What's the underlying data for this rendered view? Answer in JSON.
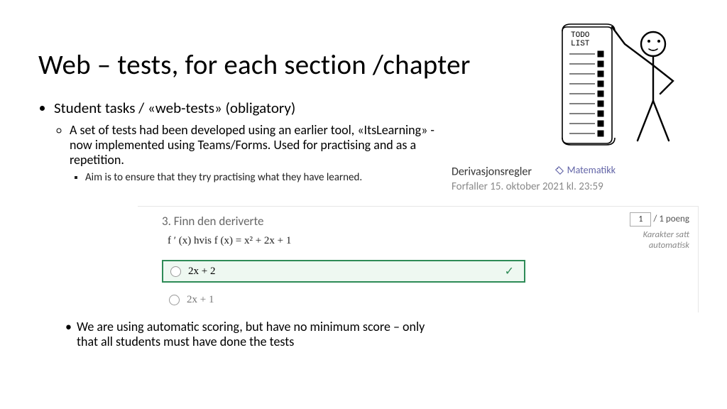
{
  "title": "Web – tests, for each section /chapter",
  "bullets": {
    "l1": "Student tasks / «web-tests» (obligatory)",
    "l2": "A set of tests had been developed using an earlier tool, «ItsLearning» - now implemented using Teams/Forms. Used for practising and as a repetition.",
    "l3": "Aim is to ensure that they try practising what they have learned.",
    "footer": "We are using automatic scoring, but have no minimum score – only that all students must have done the tests"
  },
  "assignment": {
    "name": "Derivasjonsregler",
    "tag": "Matematikk",
    "due": "Forfaller 15. oktober 2021 kl. 23:59"
  },
  "question": {
    "number_label": "3. Finn den deriverte",
    "formula": "f ′ (x)  hvis f (x) = x² + 2x + 1",
    "option_correct": "2x + 2",
    "option_wrong": "2x + 1",
    "score_value": "1",
    "score_suffix": "/ 1 poeng",
    "auto_line1": "Karakter satt",
    "auto_line2": "automatisk"
  },
  "todo": {
    "heading": "TODO\nLIST"
  }
}
